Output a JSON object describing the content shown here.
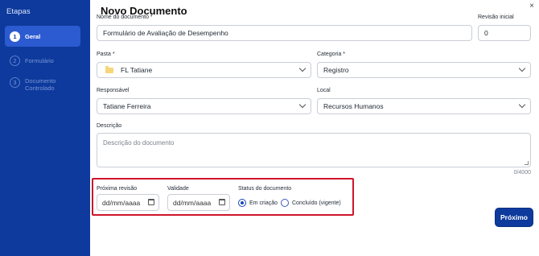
{
  "sidebar": {
    "title": "Etapas",
    "steps": [
      {
        "num": "1",
        "label": "Geral"
      },
      {
        "num": "2",
        "label": "Formulário"
      },
      {
        "num": "3",
        "label": "Documento Controlado"
      }
    ]
  },
  "header": {
    "title": "Novo Documento",
    "close": "×"
  },
  "form": {
    "nome_label": "Nome do documento *",
    "nome_value": "Formulário de Avaliação de Desempenho",
    "revisao_label": "Revisão inicial",
    "revisao_value": "0",
    "pasta_label": "Pasta *",
    "pasta_value": "FL Tatiane",
    "categoria_label": "Categoria *",
    "categoria_value": "Registro",
    "responsavel_label": "Responsável",
    "responsavel_value": "Tatiane Ferreira",
    "local_label": "Local",
    "local_value": "Recursos Humanos",
    "descricao_label": "Descrição",
    "descricao_placeholder": "Descrição do documento",
    "descricao_counter": "0/4000",
    "proxima_revisao_label": "Próxima revisão",
    "proxima_revisao_placeholder": "dd/mm/aaaa",
    "validade_label": "Validade",
    "validade_placeholder": "dd/mm/aaaa",
    "status_label": "Status do documento",
    "status_options": [
      "Em criação",
      "Concluído (vigente)"
    ],
    "status_selected": "Em criação"
  },
  "footer": {
    "next_label": "Próximo"
  },
  "colors": {
    "sidebar": "#0d3a9c",
    "active_step": "#2c5ad0",
    "highlight": "#d0142c",
    "primary": "#0d3a9c"
  }
}
